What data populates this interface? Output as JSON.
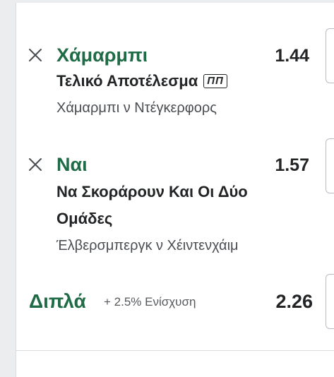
{
  "selections": [
    {
      "pick": "Χάμαρμπι",
      "market": "Τελικό Αποτέλεσμα",
      "badge": "ΠΠ",
      "event": "Χάμαρμπι ν Ντέγκερφορς",
      "odds": "1.44"
    },
    {
      "pick": "Ναι",
      "market_line1": "Να Σκοράρουν Και Οι Δύο",
      "market_line2": "Ομάδες",
      "event": "Έλβερσμπεργκ ν Χέιντενχάιμ",
      "odds": "1.57"
    }
  ],
  "double": {
    "label": "Διπλά",
    "boost": "+ 2.5% Ενίσχυση",
    "odds": "2.26"
  },
  "colors": {
    "accent": "#1f6b45",
    "text": "#222426",
    "muted": "#4a4d51"
  }
}
